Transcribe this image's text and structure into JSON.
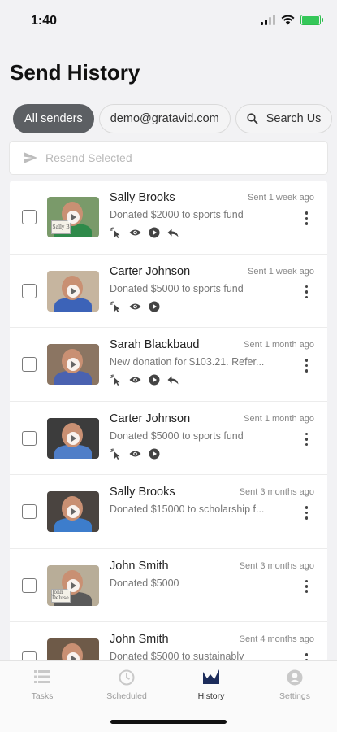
{
  "status": {
    "time": "1:40"
  },
  "header": {
    "title": "Send History"
  },
  "filters": [
    {
      "label": "All senders",
      "active": true
    },
    {
      "label": "demo@gratavid.com",
      "active": false
    },
    {
      "label": "Search Us",
      "active": false,
      "icon": "search-icon"
    }
  ],
  "resend": {
    "label": "Resend Selected",
    "icon": "send-icon"
  },
  "history": [
    {
      "name": "Sally Brooks",
      "sent": "Sent 1 week ago",
      "description": "Donated $2000 to sports fund",
      "sign_text": "Sally B",
      "actions": [
        "click-icon",
        "eye-icon",
        "play-icon",
        "reply-icon"
      ]
    },
    {
      "name": "Carter Johnson",
      "sent": "Sent 1 week ago",
      "description": "Donated $5000 to sports fund",
      "sign_text": "",
      "actions": [
        "click-icon",
        "eye-icon",
        "play-icon"
      ]
    },
    {
      "name": "Sarah Blackbaud",
      "sent": "Sent 1 month ago",
      "description": "New donation for $103.21. Refer...",
      "sign_text": "",
      "actions": [
        "click-icon",
        "eye-icon",
        "play-icon",
        "reply-icon"
      ]
    },
    {
      "name": "Carter Johnson",
      "sent": "Sent 1 month ago",
      "description": "Donated $5000 to sports fund",
      "sign_text": "",
      "actions": [
        "click-icon",
        "eye-icon",
        "play-icon"
      ]
    },
    {
      "name": "Sally Brooks",
      "sent": "Sent 3 months ago",
      "description": "Donated $15000 to scholarship f...",
      "sign_text": "",
      "actions": []
    },
    {
      "name": "John Smith",
      "sent": "Sent 3 months ago",
      "description": "Donated $5000",
      "sign_text": "John Deluse",
      "actions": []
    },
    {
      "name": "John Smith",
      "sent": "Sent 4 months ago",
      "description": "Donated $5000 to sustainably",
      "sign_text": "",
      "actions": []
    }
  ],
  "tabs": [
    {
      "label": "Tasks",
      "icon": "tasks-icon",
      "active": false
    },
    {
      "label": "Scheduled",
      "icon": "clock-icon",
      "active": false
    },
    {
      "label": "History",
      "icon": "chart-icon",
      "active": true
    },
    {
      "label": "Settings",
      "icon": "person-icon",
      "active": false
    }
  ],
  "colors": {
    "accent": "#1c2c5b",
    "chip_active": "#5c5f63",
    "battery": "#35c759"
  }
}
